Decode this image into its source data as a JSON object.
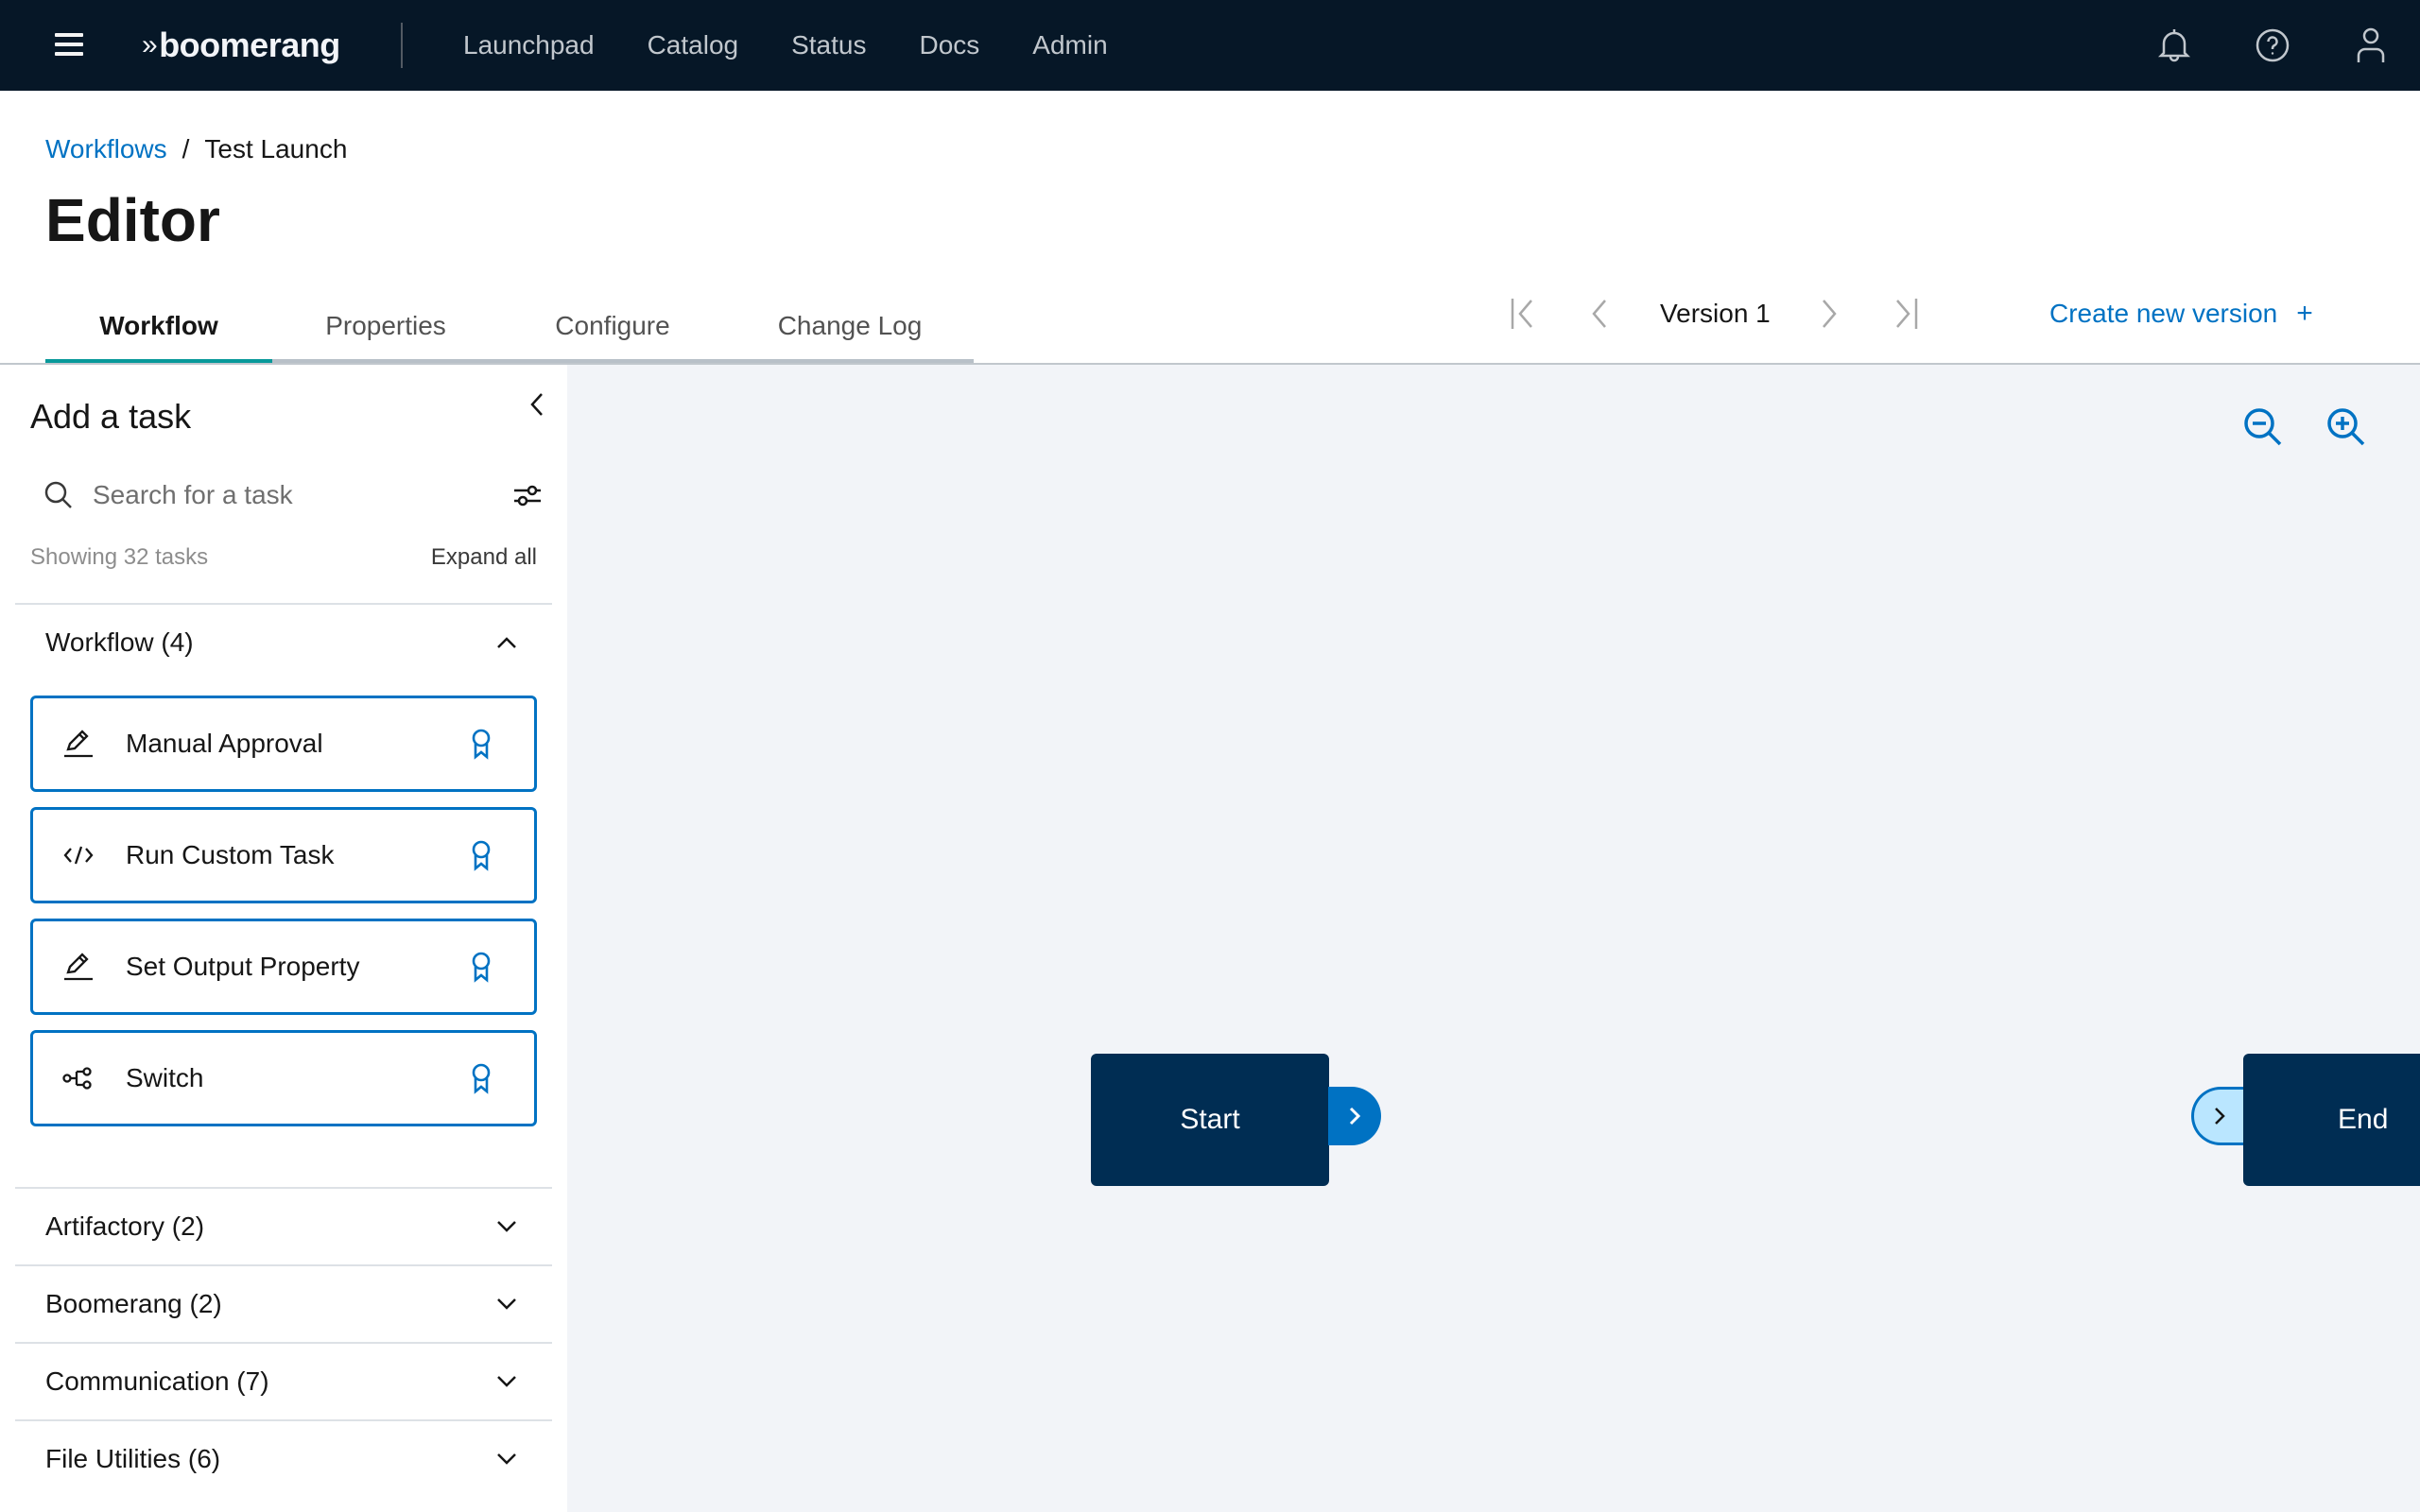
{
  "topbar": {
    "brand": "boomerang",
    "nav": [
      "Launchpad",
      "Catalog",
      "Status",
      "Docs",
      "Admin"
    ],
    "icons": [
      "bell-icon",
      "help-icon",
      "user-icon"
    ]
  },
  "breadcrumb": {
    "parent": "Workflows",
    "separator": "/",
    "current": "Test Launch"
  },
  "page_title": "Editor",
  "tabs": [
    {
      "label": "Workflow",
      "active": true
    },
    {
      "label": "Properties",
      "active": false
    },
    {
      "label": "Configure",
      "active": false
    },
    {
      "label": "Change Log",
      "active": false
    }
  ],
  "version": {
    "label": "Version 1",
    "create_label": "Create new version",
    "create_icon": "+"
  },
  "sidebar": {
    "title": "Add a task",
    "search_placeholder": "Search for a task",
    "search_value": "",
    "showing": "Showing 32 tasks",
    "expand_all": "Expand all",
    "categories": [
      {
        "label": "Workflow (4)",
        "expanded": true,
        "tasks": [
          {
            "label": "Manual Approval",
            "icon": "edit-icon"
          },
          {
            "label": "Run Custom Task",
            "icon": "code-icon"
          },
          {
            "label": "Set Output Property",
            "icon": "edit-icon"
          },
          {
            "label": "Switch",
            "icon": "switch-flow-icon"
          }
        ]
      },
      {
        "label": "Artifactory (2)",
        "expanded": false
      },
      {
        "label": "Boomerang (2)",
        "expanded": false
      },
      {
        "label": "Communication (7)",
        "expanded": false
      },
      {
        "label": "File Utilities (6)",
        "expanded": false
      }
    ]
  },
  "canvas": {
    "nodes": [
      {
        "label": "Start",
        "type": "start"
      },
      {
        "label": "End",
        "type": "end"
      }
    ]
  },
  "colors": {
    "topbar_bg": "#061727",
    "accent_blue": "#0072c3",
    "active_tab": "#08999a",
    "node_bg": "#002d53",
    "canvas_bg": "#f2f4f8",
    "port_in_bg": "#bae6ff"
  }
}
